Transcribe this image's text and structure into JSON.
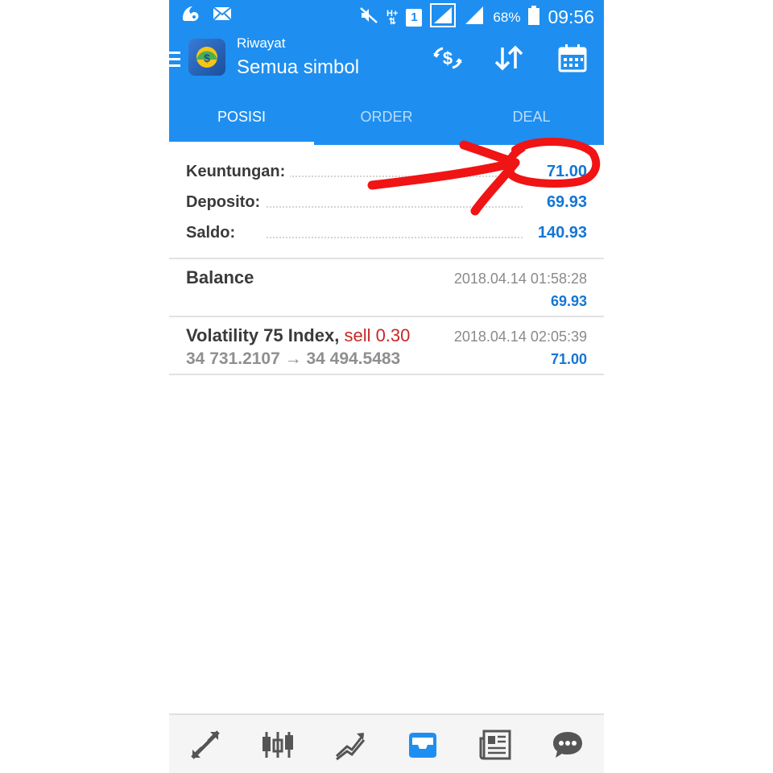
{
  "status": {
    "battery": "68%",
    "time": "09:56",
    "sim_badge": "1",
    "network": "H+"
  },
  "header": {
    "subtitle": "Riwayat",
    "title": "Semua simbol"
  },
  "tabs": [
    {
      "label": "POSISI",
      "active": true
    },
    {
      "label": "ORDER",
      "active": false
    },
    {
      "label": "DEAL",
      "active": false
    }
  ],
  "summary": [
    {
      "label": "Keuntungan:",
      "value": "71.00"
    },
    {
      "label": "Deposito:",
      "value": "69.93"
    },
    {
      "label": "Saldo:",
      "value": "140.93"
    }
  ],
  "history": [
    {
      "name": "Balance",
      "side": "",
      "prices": "",
      "date": "2018.04.14 01:58:28",
      "amount": "69.93"
    },
    {
      "name": "Volatility 75 Index,",
      "side": "sell 0.30",
      "prices": "34 731.2107 → 34 494.5483",
      "date": "2018.04.14 02:05:39",
      "amount": "71.00"
    }
  ],
  "colors": {
    "accent": "#1e8ff0",
    "value_blue": "#1476d4",
    "sell_red": "#c62828",
    "annotation_red": "#f01414"
  },
  "icons": {
    "actions": [
      "currency-exchange-icon",
      "sort-icon",
      "calendar-icon"
    ],
    "nav": [
      "trade-icon",
      "chart-icon",
      "trend-icon",
      "history-icon",
      "news-icon",
      "chat-icon"
    ]
  }
}
